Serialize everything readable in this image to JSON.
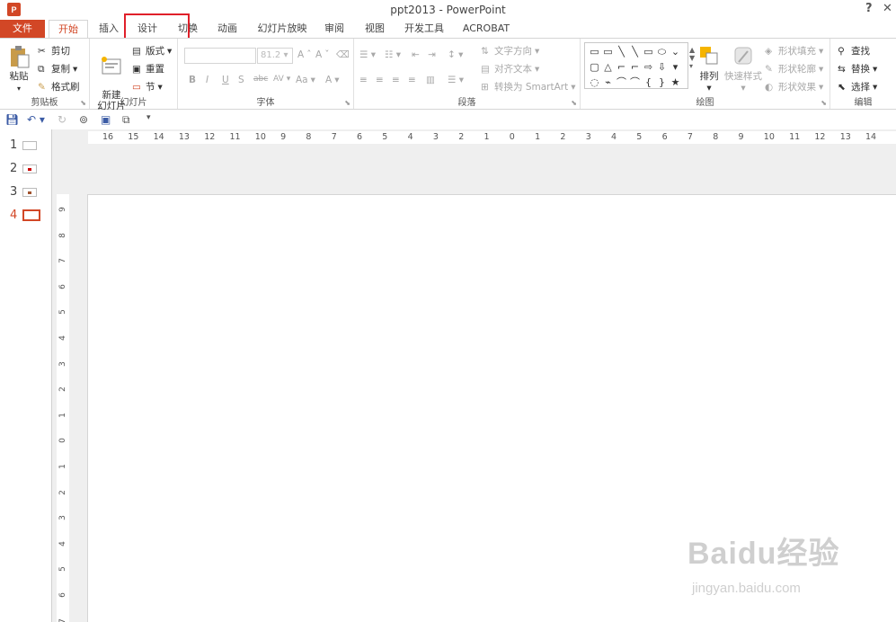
{
  "window": {
    "title": "ppt2013 - PowerPoint",
    "logo": "P",
    "help": "?",
    "close": "✕"
  },
  "tabs": [
    "文件",
    "开始",
    "插入",
    "设计",
    "切换",
    "动画",
    "幻灯片放映",
    "审阅",
    "视图",
    "开发工具",
    "ACROBAT"
  ],
  "colors": {
    "accent": "#d24726",
    "highlight": "#e0202a"
  },
  "ribbon": {
    "clipboard": {
      "paste": "粘贴",
      "cut": "剪切",
      "copy": "复制",
      "format_painter": "格式刷",
      "label": "剪贴板"
    },
    "slides": {
      "new_slide": "新建\n幻灯片",
      "layout": "版式",
      "reset": "重置",
      "section": "节",
      "label": "幻灯片"
    },
    "font": {
      "size": "81.2",
      "label": "字体",
      "bold": "B",
      "italic": "I",
      "underline": "U",
      "strike": "S",
      "shadow": "abc",
      "spacing": "AV",
      "case": "Aa",
      "color": "A",
      "grow": "A",
      "shrink": "A"
    },
    "paragraph": {
      "text_direction": "文字方向",
      "align_text": "对齐文本",
      "smartart": "转换为 SmartArt",
      "label": "段落"
    },
    "drawing": {
      "arrange": "排列",
      "quick_styles": "快速样式",
      "shape_fill": "形状填充",
      "shape_outline": "形状轮廓",
      "shape_effects": "形状效果",
      "label": "绘图"
    },
    "editing": {
      "find": "查找",
      "replace": "替换",
      "select": "选择",
      "label": "编辑"
    }
  },
  "shapes": [
    "▭",
    "▭",
    "╲",
    "╲",
    "▭",
    "⬭",
    "⌄",
    "▢",
    "△",
    "⌐",
    "⌐",
    "⇨",
    "⇩",
    "▾",
    "◌",
    "⌁",
    "⌒",
    "⌒",
    "{",
    "}",
    "★"
  ],
  "slides": [
    {
      "num": "1"
    },
    {
      "num": "2"
    },
    {
      "num": "3"
    },
    {
      "num": "4",
      "active": true
    }
  ],
  "hruler": [
    "16",
    "15",
    "14",
    "13",
    "12",
    "11",
    "10",
    "9",
    "8",
    "7",
    "6",
    "5",
    "4",
    "3",
    "2",
    "1",
    "0",
    "1",
    "2",
    "3",
    "4",
    "5",
    "6",
    "7",
    "8",
    "9",
    "10",
    "11",
    "12",
    "13",
    "14"
  ],
  "vruler": [
    "9",
    "8",
    "7",
    "6",
    "5",
    "4",
    "3",
    "2",
    "1",
    "0",
    "1",
    "2",
    "3",
    "4",
    "5",
    "6",
    "7"
  ],
  "watermark": {
    "main": "Baidu经验",
    "sub": "jingyan.baidu.com"
  }
}
